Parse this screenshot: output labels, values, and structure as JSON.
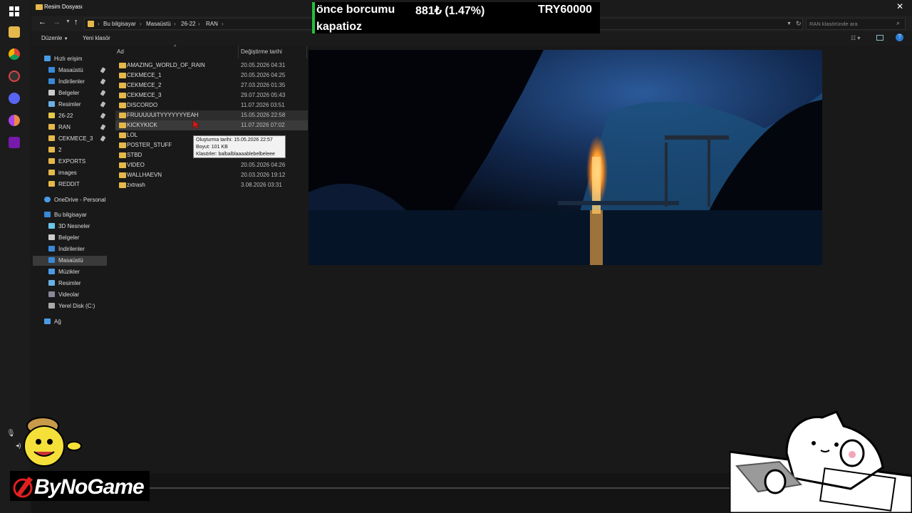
{
  "window": {
    "title": "Resim Dosyası"
  },
  "address": {
    "crumbs": [
      "Bu bilgisayar",
      "Masaüstü",
      "26-22",
      "RAN"
    ],
    "search_placeholder": "RAN klasöründe ara"
  },
  "ribbon": {
    "organize": "Düzenle",
    "new_folder": "Yeni klasör"
  },
  "nav": {
    "quick_access": "Hızlı erişim",
    "quick_items": [
      "Masaüstü",
      "İndirilenler",
      "Belgeler",
      "Resimler",
      "26-22",
      "RAN",
      "CEKMECE_3",
      "2",
      "EXPORTS",
      "images",
      "REDDIT"
    ],
    "onedrive": "OneDrive - Personal",
    "this_pc": "Bu bilgisayar",
    "pc_items": [
      "3D Nesneler",
      "Belgeler",
      "İndirilenler",
      "Masaüstü",
      "Müzikler",
      "Resimler",
      "Videolar",
      "Yerel Disk (C:)"
    ],
    "network": "Ağ"
  },
  "columns": {
    "name": "Ad",
    "modified": "Değiştirme tarihi"
  },
  "files": [
    {
      "name": "AMAZING_WORLD_OF_RAIN",
      "date": "20.05.2026 04:31"
    },
    {
      "name": "CEKMECE_1",
      "date": "20.05.2026 04:25"
    },
    {
      "name": "CEKMECE_2",
      "date": "27.03.2026 01:35"
    },
    {
      "name": "CEKMECE_3",
      "date": "29.07.2026 05:43"
    },
    {
      "name": "DISCORDO",
      "date": "11.07.2026 03:51"
    },
    {
      "name": "FRUUUUUITYYYYYYYEAH",
      "date": "15.05.2026 22:58"
    },
    {
      "name": "KICKYKICK",
      "date": "11.07.2026 07:02"
    },
    {
      "name": "LOL",
      "date": ""
    },
    {
      "name": "POSTER_STUFF",
      "date": ""
    },
    {
      "name": "STBD",
      "date": ""
    },
    {
      "name": "VIDEO",
      "date": "20.05.2026 04:26"
    },
    {
      "name": "WALLHAEVN",
      "date": "20.03.2026 19:12"
    },
    {
      "name": "zxtrash",
      "date": "3.08.2026 03:31"
    }
  ],
  "tooltip": {
    "created": "Oluşturma tarihi: 15.05.2026 22:57",
    "size": "Boyut: 101 KB",
    "folders": "Klasörler: balbalblaaaablebelbeleee"
  },
  "ticker": {
    "line1": "önce borcumu",
    "amount": "881₺ (1.47%)",
    "goal": "TRY60000",
    "line2": "kapatioz"
  },
  "overlay": {
    "brand": "ByNoGame"
  },
  "colors": {
    "folder": "#e6b84b",
    "ticker_bar": "#22c13a",
    "selection": "#3a3a3a"
  }
}
